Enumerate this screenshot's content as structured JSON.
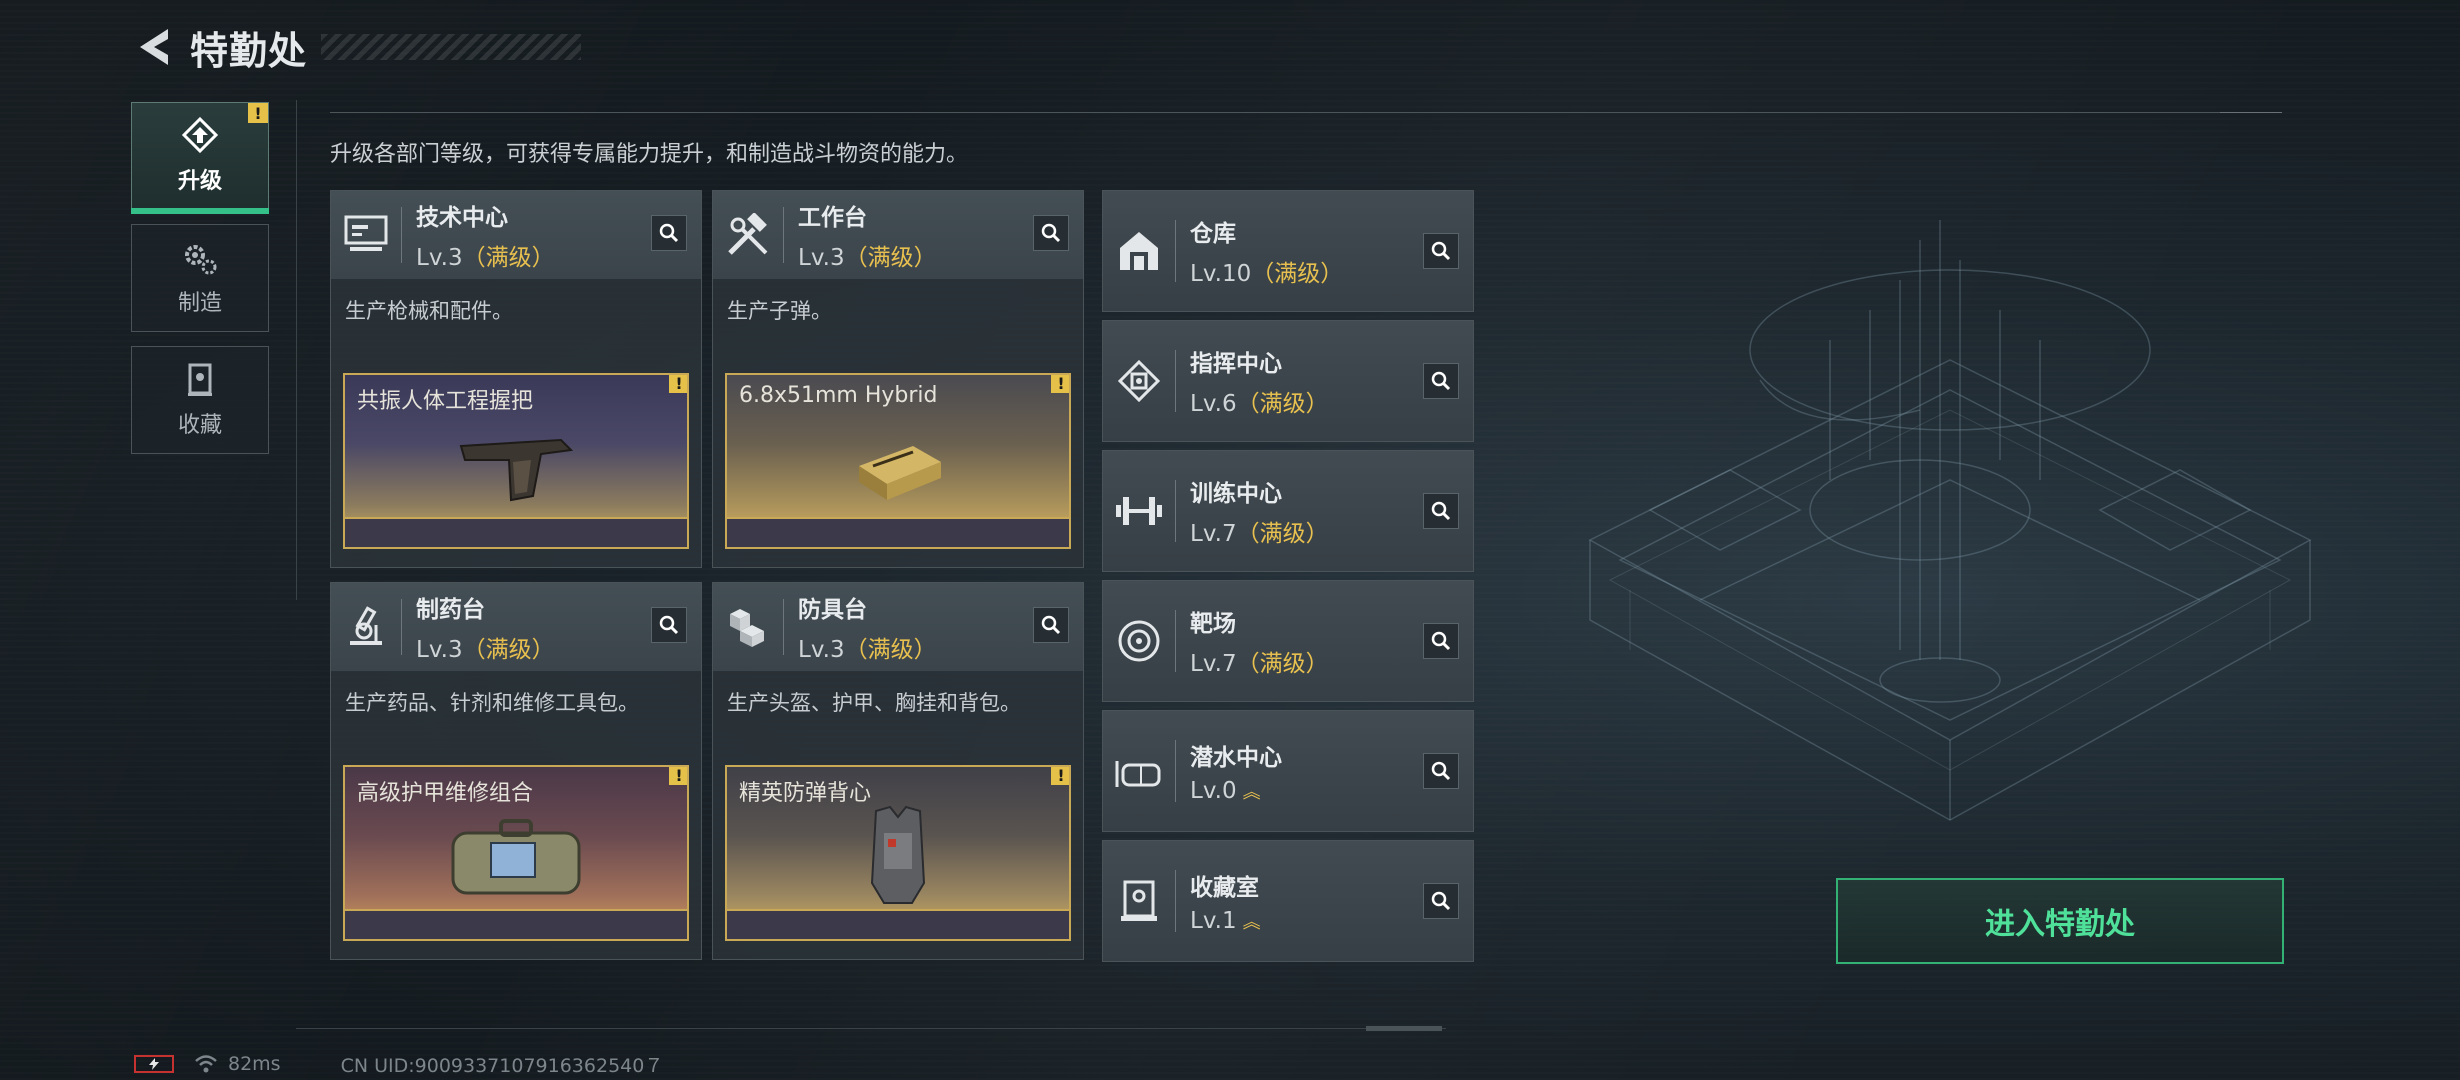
{
  "header": {
    "title": "特勤处"
  },
  "sidebar": {
    "tabs": [
      {
        "label": "升级",
        "active": true,
        "badge": "!"
      },
      {
        "label": "制造",
        "active": false
      },
      {
        "label": "收藏",
        "active": false
      }
    ]
  },
  "description": "升级各部门等级，可获得专属能力提升，和制造战斗物资的能力。",
  "big_cards": [
    {
      "title": "技术中心",
      "level": "Lv.3",
      "max": "（满级）",
      "desc": "生产枪械和配件。",
      "product": "共振人体工程握把",
      "badge": "!"
    },
    {
      "title": "工作台",
      "level": "Lv.3",
      "max": "（满级）",
      "desc": "生产子弹。",
      "product": "6.8x51mm Hybrid",
      "badge": "!"
    },
    {
      "title": "制药台",
      "level": "Lv.3",
      "max": "（满级）",
      "desc": "生产药品、针剂和维修工具包。",
      "product": "高级护甲维修组合",
      "badge": "!"
    },
    {
      "title": "防具台",
      "level": "Lv.3",
      "max": "（满级）",
      "desc": "生产头盔、护甲、胸挂和背包。",
      "product": "精英防弹背心",
      "badge": "!"
    }
  ],
  "slots": [
    {
      "title": "仓库",
      "level": "Lv.10",
      "max": "（满级）"
    },
    {
      "title": "指挥中心",
      "level": "Lv.6",
      "max": "（满级）"
    },
    {
      "title": "训练中心",
      "level": "Lv.7",
      "max": "（满级）"
    },
    {
      "title": "靶场",
      "level": "Lv.7",
      "max": "（满级）"
    },
    {
      "title": "潜水中心",
      "level": "Lv.0",
      "upgrade": "︽"
    },
    {
      "title": "收藏室",
      "level": "Lv.1",
      "upgrade": "︽"
    }
  ],
  "enter_button": "进入特勤处",
  "footer": {
    "ping": "82ms",
    "uid": "CN UID:9009337107916362540７"
  },
  "colors": {
    "accent_green": "#35c08a",
    "max_gold": "#e8c04f",
    "warn_yellow": "#e6c14a"
  }
}
